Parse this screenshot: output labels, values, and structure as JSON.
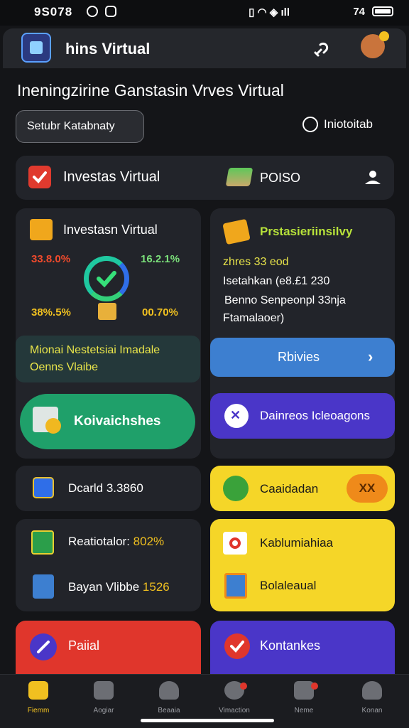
{
  "status_bar": {
    "time": "9S078",
    "right": "74"
  },
  "app": {
    "title": "hins Virtual"
  },
  "headline": "Ineningzirine Ganstasin Vrves Virtual",
  "search": {
    "label": "Setubr Katabnaty"
  },
  "info_link": {
    "label": "Iniotoitab"
  },
  "investas_bar": {
    "label": "Investas Virtual",
    "value": "POISO"
  },
  "card_left": {
    "title": "Investasn Virtual",
    "stat_tl": "33.8.0%",
    "stat_tr": "16.2.1%",
    "stat_bl": "38%.5%",
    "stat_br": "00.70%",
    "note_line1": "Mionai Nestetsiai Imadale",
    "note_line2": "Oenns Vlaibe",
    "action_label": "Koivaichshes"
  },
  "card_right": {
    "title": "Prstasieriinsilvy",
    "line1": "zhres 33 eod",
    "line2": "Isetahkan (e8.£1 230",
    "line3": "Benno Senpeonpl 33nja",
    "line4": "Ftamalaoer)",
    "button1": "Rbivies",
    "button2": "Dainreos Icleoagons"
  },
  "tile_dashboard": {
    "label": "Dcarld 3.3860"
  },
  "tile_conversion": {
    "label": "Caaidadan",
    "badge": "XX"
  },
  "tile_stats": {
    "line1_label": "Reatiotalor:",
    "line1_value": "802%",
    "line2_label": "Bayan Vlibbe",
    "line2_value": "1526"
  },
  "tile_yellow": {
    "item1": "Kablumiahiaa",
    "item2": "Bolaleaual"
  },
  "tile_red": {
    "label": "Paiial"
  },
  "tile_purple": {
    "label": "Kontankes"
  },
  "nav": [
    {
      "label": "Fiemm",
      "active": true
    },
    {
      "label": "Aogiar"
    },
    {
      "label": "Beaaia"
    },
    {
      "label": "Vimaction"
    },
    {
      "label": "Neme"
    },
    {
      "label": "Konan"
    }
  ],
  "colors": {
    "green": "#1fa06a",
    "blue": "#3d7fd0",
    "purple": "#4a36c8",
    "yellow": "#f5d628",
    "red": "#e0362c",
    "orange": "#ef8a1a"
  }
}
